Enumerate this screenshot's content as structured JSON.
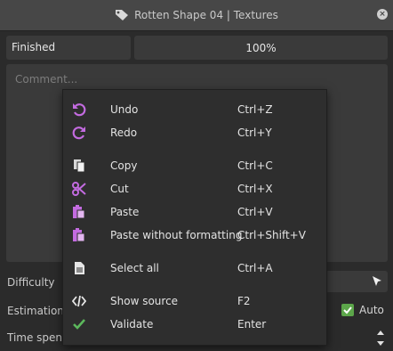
{
  "window": {
    "title": "Rotten Shape 04 | Textures"
  },
  "status": {
    "value": "Finished",
    "progress": "100%"
  },
  "comment": {
    "placeholder": "Comment..."
  },
  "fields": {
    "difficulty_label": "Difficulty",
    "estimation_label": "Estimation",
    "time_spent_label": "Time spent",
    "auto_label": "Auto",
    "auto_checked": true
  },
  "menu": {
    "items": [
      {
        "label": "Undo",
        "shortcut": "Ctrl+Z",
        "icon": "undo-icon"
      },
      {
        "label": "Redo",
        "shortcut": "Ctrl+Y",
        "icon": "redo-icon"
      },
      {
        "label": "Copy",
        "shortcut": "Ctrl+C",
        "icon": "copy-icon"
      },
      {
        "label": "Cut",
        "shortcut": "Ctrl+X",
        "icon": "scissors-icon"
      },
      {
        "label": "Paste",
        "shortcut": "Ctrl+V",
        "icon": "paste-icon"
      },
      {
        "label": "Paste without formatting",
        "shortcut": "Ctrl+Shift+V",
        "icon": "paste-plain-icon"
      },
      {
        "label": "Select all",
        "shortcut": "Ctrl+A",
        "icon": "document-icon"
      },
      {
        "label": "Show source",
        "shortcut": "F2",
        "icon": "code-icon"
      },
      {
        "label": "Validate",
        "shortcut": "Enter",
        "icon": "check-icon"
      }
    ]
  },
  "colors": {
    "accent_purple": "#c36be0",
    "check_green": "#5cb85c"
  }
}
